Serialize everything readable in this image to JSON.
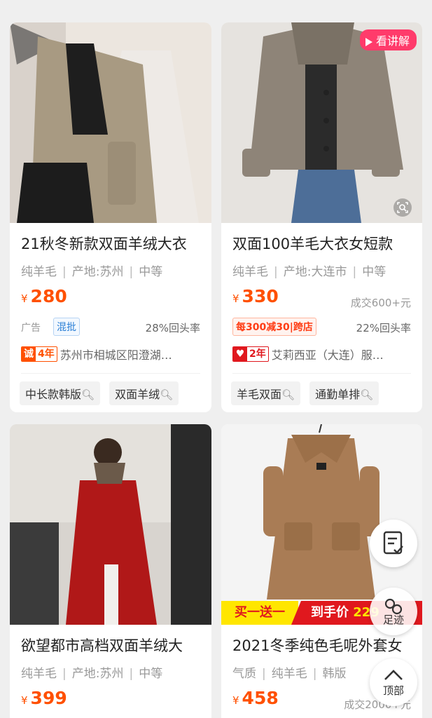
{
  "products": [
    {
      "title": "21秋冬新款双面羊绒大衣",
      "attrs": [
        "纯羊毛",
        "产地:苏州",
        "中等"
      ],
      "currency": "¥",
      "price": "280",
      "ad_label": "广告",
      "tag": "混批",
      "repurchase": "28%回头率",
      "shop_badge_icon": "诚",
      "shop_years": "4年",
      "shop_name": "苏州市相城区阳澄湖…",
      "chips": [
        "中长款韩版",
        "双面羊绒"
      ]
    },
    {
      "title": "双面100羊毛大衣女短款",
      "attrs": [
        "纯羊毛",
        "产地:大连市",
        "中等"
      ],
      "currency": "¥",
      "price": "330",
      "sold": "成交600+元",
      "promo_tag": "每300减30|跨店",
      "repurchase": "22%回头率",
      "shop_years": "2年",
      "shop_name": "艾莉西亚（大连）服…",
      "chips": [
        "羊毛双面",
        "通勤单排"
      ],
      "video_pill": "看讲解"
    },
    {
      "title": "欲望都市高档双面羊绒大",
      "attrs": [
        "纯羊毛",
        "产地:苏州",
        "中等"
      ],
      "currency": "¥",
      "price": "399"
    },
    {
      "title": "2021冬季纯色毛呢外套女",
      "attrs": [
        "气质",
        "纯羊毛",
        "韩版"
      ],
      "currency": "¥",
      "price": "458",
      "sold": "成交2000+元",
      "banner_left": "买一送一",
      "banner_right_label": "到手价",
      "banner_right_price": "229"
    }
  ],
  "floating": {
    "footprint_label": "足迹",
    "top_label": "顶部"
  },
  "colors": {
    "price": "#ff5000",
    "pill": "#ff3b6b",
    "promo_red": "#e0181e",
    "promo_yellow": "#ffe600"
  }
}
